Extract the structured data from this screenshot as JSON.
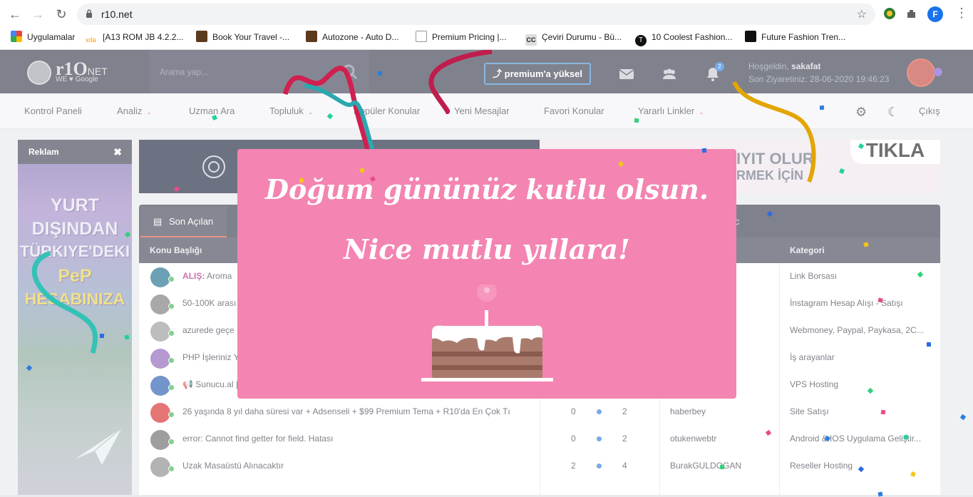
{
  "browser": {
    "url": "r10.net",
    "profile_initial": "F",
    "bookmarks": [
      {
        "label": "Uygulamalar",
        "color": "#e8453c"
      },
      {
        "label": "[A13 ROM JB 4.2.2...",
        "color": "#ff9800"
      },
      {
        "label": "Book Your Travel -...",
        "color": "#5b3a1c"
      },
      {
        "label": "Autozone - Auto D...",
        "color": "#5b3a1c"
      },
      {
        "label": "Premium Pricing |...",
        "color": "#888888"
      },
      {
        "label": "Çeviri Durumu - Bü...",
        "color": "#444444"
      },
      {
        "label": "10 Coolest Fashion...",
        "color": "#111111"
      },
      {
        "label": "Future Fashion Tren...",
        "color": "#111111"
      }
    ],
    "bookmarks_more": "»"
  },
  "header": {
    "logo_text": "r1O",
    "logo_suffix": "NET",
    "logo_tagline": "WE ♥ Google",
    "search_placeholder": "Arama yap...",
    "premium_label": "⤴ premium'a yüksel",
    "notification_count": "2",
    "welcome_prefix": "Hoşgeldin,",
    "username": "sakafat",
    "last_visit": "Son Ziyaretiniz: 28-06-2020 19:46:23"
  },
  "nav": {
    "items": [
      {
        "label": "Kontrol Paneli",
        "caret": false
      },
      {
        "label": "Analiz",
        "caret": true
      },
      {
        "label": "Uzman Ara",
        "caret": false
      },
      {
        "label": "Topluluk",
        "caret": true
      },
      {
        "label": "Popüler Konular",
        "caret": false
      },
      {
        "label": "Yeni Mesajlar",
        "caret": false
      },
      {
        "label": "Favori Konular",
        "caret": false
      },
      {
        "label": "Yararlı Linkler",
        "caret": true
      }
    ],
    "logout": "Çıkış"
  },
  "side_ad": {
    "title": "Reklam",
    "lines": [
      "YURT",
      "DIŞINDAN",
      "TÜRKIYE'DEKI",
      "PeP",
      "HESABINIZA"
    ]
  },
  "banner": {
    "line1": "IYIT OLUR",
    "line2": "RMEK İÇİN",
    "cta": "TIKLA"
  },
  "tabs": {
    "active": "Son Açılan",
    "ghost": "ic"
  },
  "table": {
    "headers": {
      "title": "Konu Başlığı",
      "category": "Kategori"
    },
    "rows": [
      {
        "title": "ALIŞ: Aroma",
        "title_prefix": "ALIŞ:",
        "replies": "",
        "views": "",
        "user": "",
        "category": "Link Borsası",
        "avatar": "#1e6e8c"
      },
      {
        "title": "50-100K arası",
        "title_prefix": "",
        "replies": "",
        "views": "",
        "user": "",
        "category": "İnstagram Hesap Alışı - Satışı",
        "avatar": "#7a7a7a"
      },
      {
        "title": "azurede geçe",
        "title_prefix": "",
        "replies": "",
        "views": "",
        "user": "",
        "category": "Webmoney, Paypal, Paykasa, 2C...",
        "avatar": "#9a9a9a"
      },
      {
        "title": "PHP İşleriniz Y",
        "title_prefix": "",
        "replies": "",
        "views": "",
        "user": "",
        "category": "İş arayanlar",
        "avatar": "#8e63b8"
      },
      {
        "title": "📢 Sunucu.al |",
        "title_prefix": "",
        "replies": "",
        "views": "",
        "user": "",
        "category": "VPS Hosting",
        "avatar": "#2a5db0"
      },
      {
        "title": "26 yaşında 8 yıl daha süresi var + Adsenseli + $99 Premium Tema + R10'da En Çok Tı",
        "title_prefix": "",
        "replies": "0",
        "views": "2",
        "user": "haberbey",
        "category": "Site Satışı",
        "avatar": "#d72b2b"
      },
      {
        "title": "error: Cannot find getter for field. Hatası",
        "title_prefix": "",
        "replies": "0",
        "views": "2",
        "user": "otukenwebtr",
        "category": "Android & IOS Uygulama Geliştir...",
        "avatar": "#6b6b6b"
      },
      {
        "title": "Uzak Masaüstü Alınacaktır",
        "title_prefix": "",
        "replies": "2",
        "views": "4",
        "user": "BurakGULDOGAN",
        "category": "Reseller Hosting",
        "avatar": "#8a8a8a"
      }
    ]
  },
  "modal": {
    "line1": "Doğum gününüz kutlu olsun.",
    "line2": "Nice mutlu yıllara!"
  },
  "colors": {
    "header_bg": "#3b3f4f",
    "modal_bg": "#f484b1",
    "accent_red": "#e5534b",
    "accent_blue": "#2d7de0"
  }
}
